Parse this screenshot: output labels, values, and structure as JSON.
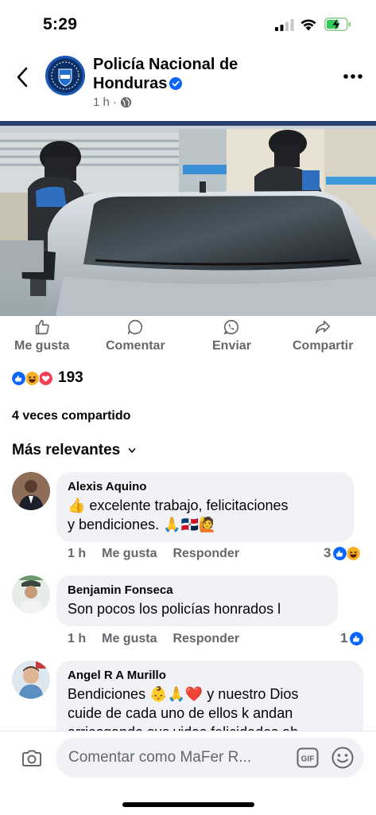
{
  "status_bar": {
    "time": "5:29"
  },
  "header": {
    "page_name": "Policía Nacional de Honduras",
    "time_ago": "1 h",
    "dot": "·",
    "avatar_text": "POLICÍA"
  },
  "actions": {
    "like": "Me gusta",
    "comment": "Comentar",
    "send": "Enviar",
    "share": "Compartir"
  },
  "reactions": {
    "count": "193"
  },
  "shares_text": "4 veces compartido",
  "sort_label": "Más relevantes",
  "comments": [
    {
      "author": "Alexis Aquino",
      "text_line1": "👍 excelente trabajo, felicitaciones",
      "text_line2": "y bendiciones. 🙏🇩🇴🙋",
      "time": "1 h",
      "like": "Me gusta",
      "reply": "Responder",
      "reaction_count": "3"
    },
    {
      "author": "Benjamin Fonseca",
      "text_line1": "Son pocos los policías honrados l",
      "time": "1 h",
      "like": "Me gusta",
      "reply": "Responder",
      "reaction_count": "1"
    },
    {
      "author": "Angel R A Murillo",
      "text_line1": "Bendiciones 👶🙏❤️ y nuestro Dios",
      "text_line2": "cuide de cada uno de ellos k andan",
      "text_line3": "arriesgando sus vidas felicidades ah"
    }
  ],
  "composer": {
    "placeholder": "Comentar como MaFer R..."
  },
  "colors": {
    "brand_blue": "#0866ff",
    "secondary_text": "#65676b",
    "bubble_bg": "#f0f2f5"
  }
}
